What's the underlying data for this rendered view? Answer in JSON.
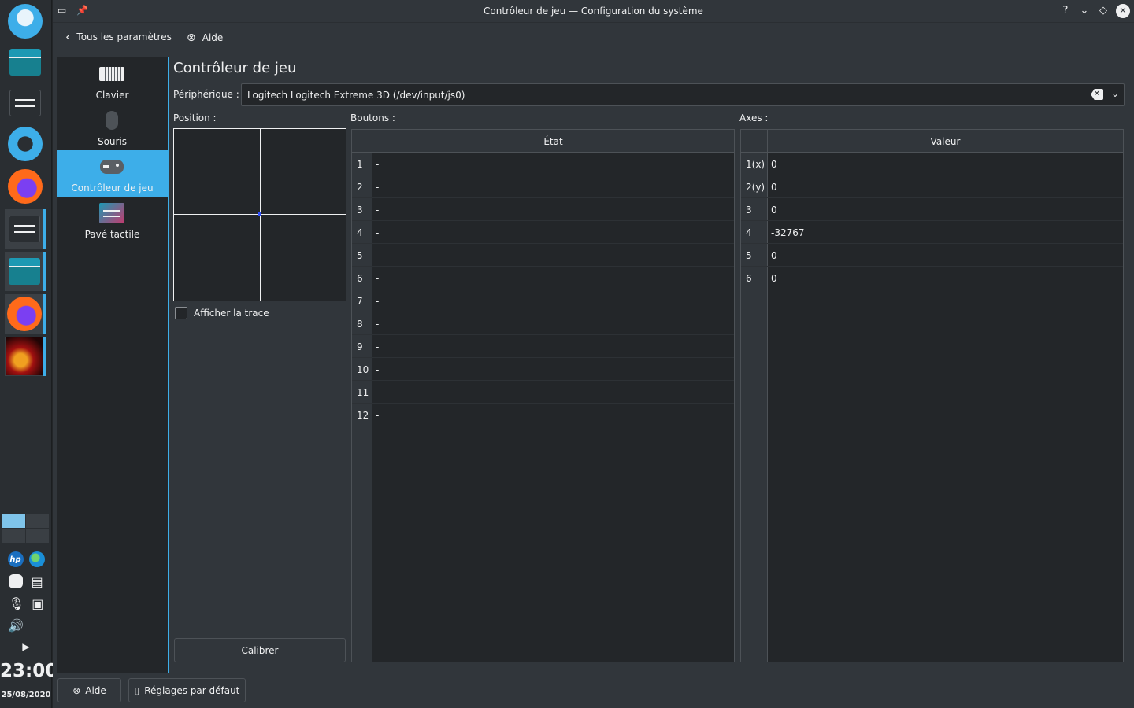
{
  "window": {
    "title": "Contrôleur de jeu — Configuration du système"
  },
  "nav": {
    "back_label": "Tous les paramètres",
    "help_label": "Aide"
  },
  "categories": [
    {
      "label": "Clavier",
      "icon": "keyboard-icon"
    },
    {
      "label": "Souris",
      "icon": "mouse-icon"
    },
    {
      "label": "Contrôleur de jeu",
      "icon": "gamepad-icon",
      "selected": true
    },
    {
      "label": "Pavé tactile",
      "icon": "touchpad-icon"
    }
  ],
  "page": {
    "title": "Contrôleur de jeu",
    "device_label": "Périphérique :",
    "device_value": "Logitech Logitech Extreme 3D (/dev/input/js0)",
    "position_label": "Position :",
    "buttons_label": "Boutons :",
    "axes_label": "Axes :",
    "trace_label": "Afficher la trace",
    "trace_checked": false,
    "calibrate_label": "Calibrer"
  },
  "buttons_table": {
    "header": "État",
    "rows": [
      {
        "num": "1",
        "state": "-"
      },
      {
        "num": "2",
        "state": "-"
      },
      {
        "num": "3",
        "state": "-"
      },
      {
        "num": "4",
        "state": "-"
      },
      {
        "num": "5",
        "state": "-"
      },
      {
        "num": "6",
        "state": "-"
      },
      {
        "num": "7",
        "state": "-"
      },
      {
        "num": "8",
        "state": "-"
      },
      {
        "num": "9",
        "state": "-"
      },
      {
        "num": "10",
        "state": "-"
      },
      {
        "num": "11",
        "state": "-"
      },
      {
        "num": "12",
        "state": "-"
      }
    ]
  },
  "axes_table": {
    "header": "Valeur",
    "rows": [
      {
        "num": "1(x)",
        "value": "0"
      },
      {
        "num": "2(y)",
        "value": "0"
      },
      {
        "num": "3",
        "value": "0"
      },
      {
        "num": "4",
        "value": "-32767"
      },
      {
        "num": "5",
        "value": "0"
      },
      {
        "num": "6",
        "value": "0"
      }
    ]
  },
  "footer": {
    "help_label": "Aide",
    "defaults_label": "Réglages par défaut"
  },
  "taskbar": {
    "clock": "23:00",
    "date": "25/08/2020"
  },
  "colors": {
    "accent": "#3daee9",
    "background": "#31363b",
    "view_background": "#232629",
    "text": "#eff0f1"
  }
}
